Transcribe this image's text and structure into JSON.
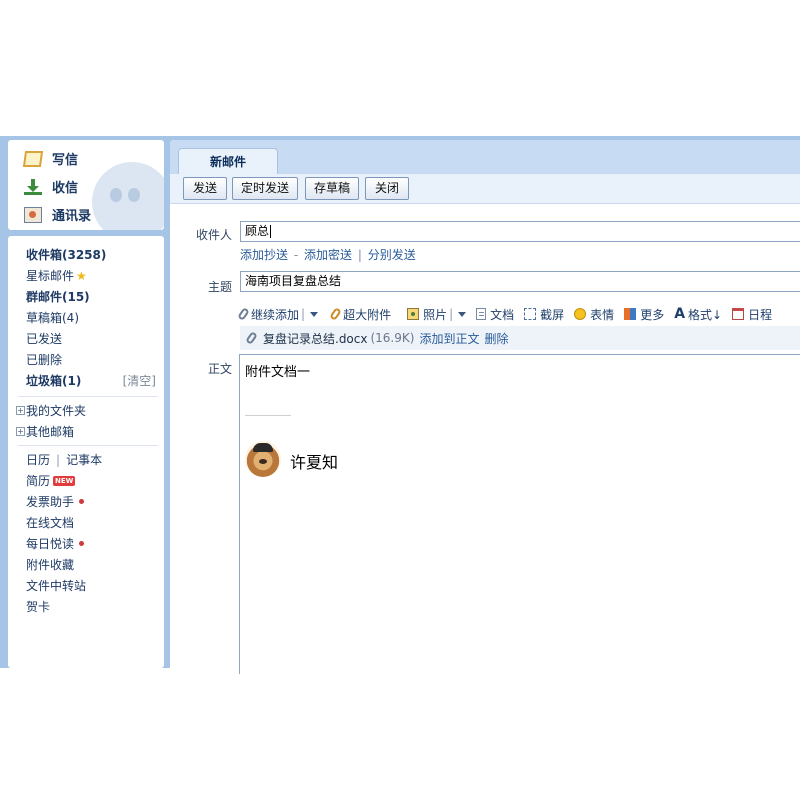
{
  "nav": {
    "compose": "写信",
    "inbox": "收信",
    "contacts": "通讯录"
  },
  "folders": {
    "inbox": "收件箱(3258)",
    "starred": "星标邮件",
    "group": "群邮件(15)",
    "drafts": "草稿箱(4)",
    "sent": "已发送",
    "deleted": "已删除",
    "spam": "垃圾箱(1)",
    "spam_clear": "[清空]"
  },
  "folder_groups": {
    "my_folders": "我的文件夹",
    "other_mailboxes": "其他邮箱"
  },
  "apps": {
    "calendar": "日历",
    "divider": "|",
    "notepad": "记事本",
    "resume": "简历",
    "new_badge": "NEW",
    "invoice": "发票助手",
    "online_docs": "在线文档",
    "daily_read": "每日悦读",
    "attachment_fav": "附件收藏",
    "file_transfer": "文件中转站",
    "greeting_card": "贺卡"
  },
  "compose": {
    "tab_title": "新邮件",
    "toolbar": {
      "send": "发送",
      "scheduled_send": "定时发送",
      "save_draft": "存草稿",
      "close": "关闭"
    },
    "to_label": "收件人",
    "to_value": "顾总",
    "cc_link": "添加抄送",
    "dash": "-",
    "bcc_link": "添加密送",
    "separate_send": "分别发送",
    "subject_label": "主题",
    "subject_value": "海南项目复盘总结",
    "format": {
      "add_attachment": "继续添加",
      "large_attachment": "超大附件",
      "photo": "照片",
      "document": "文档",
      "screenshot": "截屏",
      "emoji": "表情",
      "more": "更多",
      "format": "格式↓",
      "schedule": "日程"
    },
    "attachment": {
      "name": "复盘记录总结.docx",
      "size": "(16.9K)",
      "add_to_body": "添加到正文",
      "delete": "删除"
    },
    "body_label": "正文",
    "body_text": "附件文档一",
    "signature_name": "许夏知"
  }
}
